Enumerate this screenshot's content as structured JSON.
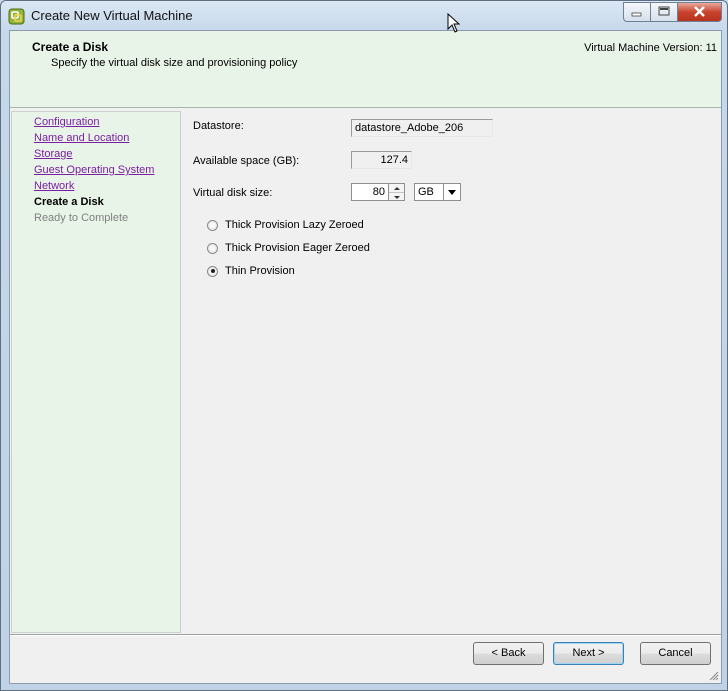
{
  "window": {
    "title": "Create New Virtual Machine"
  },
  "header": {
    "title": "Create a Disk",
    "subtitle": "Specify the virtual disk size and provisioning policy",
    "version": "Virtual Machine Version: 11"
  },
  "nav": {
    "items": [
      {
        "label": "Configuration",
        "state": "link"
      },
      {
        "label": "Name and Location",
        "state": "link"
      },
      {
        "label": "Storage",
        "state": "link"
      },
      {
        "label": "Guest Operating System",
        "state": "link"
      },
      {
        "label": "Network",
        "state": "link"
      },
      {
        "label": "Create a Disk",
        "state": "current"
      },
      {
        "label": "Ready to Complete",
        "state": "disabled"
      }
    ]
  },
  "form": {
    "datastore_label": "Datastore:",
    "datastore_value": "datastore_Adobe_206",
    "available_label": "Available space (GB):",
    "available_value": "127.4",
    "disk_size_label": "Virtual disk size:",
    "disk_size_value": "80",
    "unit_value": "GB",
    "options": [
      {
        "label": "Thick Provision Lazy Zeroed",
        "checked": false
      },
      {
        "label": "Thick Provision Eager Zeroed",
        "checked": false
      },
      {
        "label": "Thin Provision",
        "checked": true
      }
    ]
  },
  "buttons": {
    "back": "< Back",
    "next": "Next >",
    "cancel": "Cancel"
  },
  "icons": {
    "app": "vsphere-logo-icon",
    "minimize": "minimize-icon",
    "maximize": "maximize-icon",
    "close": "close-icon",
    "cursor": "mouse-pointer-icon"
  }
}
